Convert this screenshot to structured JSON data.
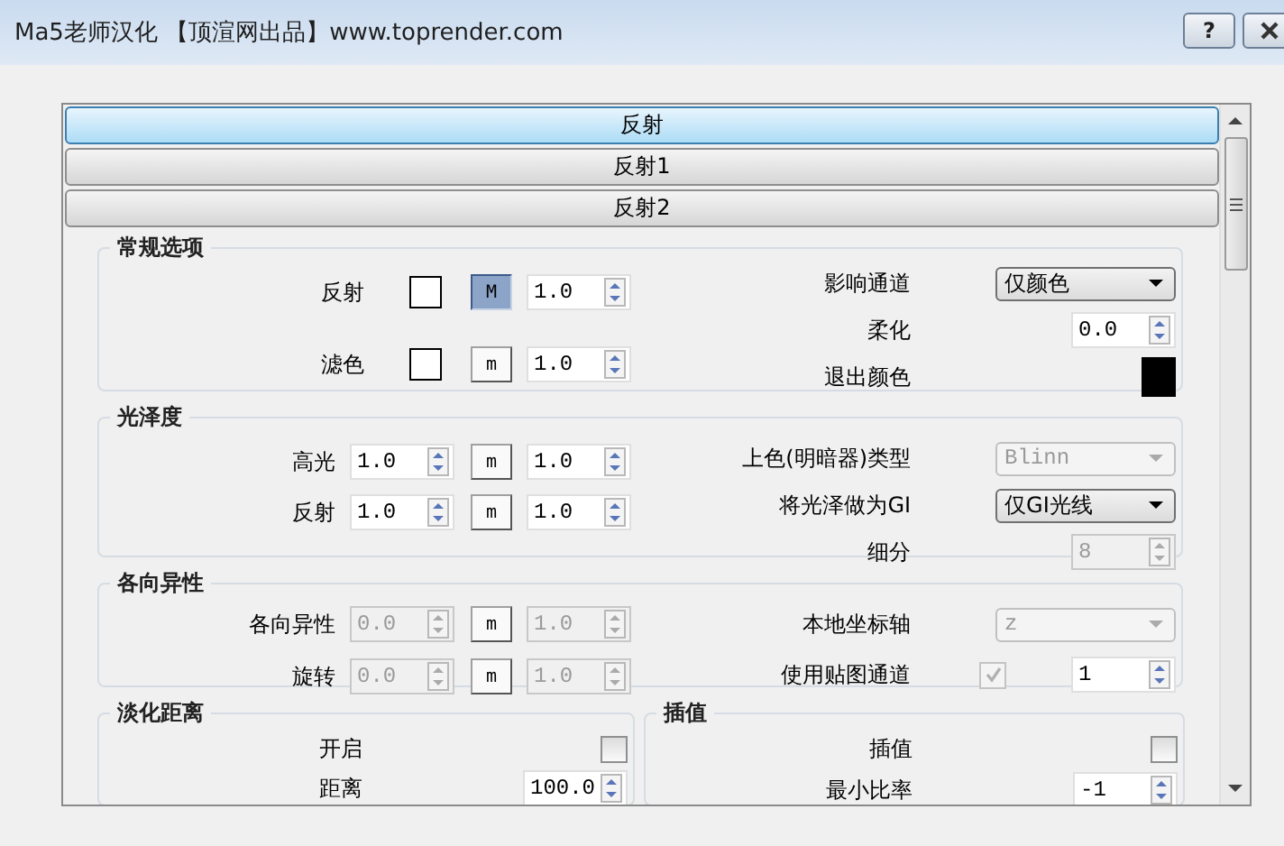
{
  "window": {
    "title": "Ma5老师汉化 【顶渲网出品】www.toprender.com",
    "help_button": "?"
  },
  "rollouts": [
    {
      "label": "反射",
      "selected": true
    },
    {
      "label": "反射1",
      "selected": false
    },
    {
      "label": "反射2",
      "selected": false
    }
  ],
  "sections": [
    {
      "kind": "split",
      "title": "常规选项",
      "left": [
        {
          "label": "反射",
          "controls": [
            {
              "kind": "swatch",
              "color": "#ffffff"
            },
            {
              "kind": "map_button",
              "label": "M",
              "pressed": true
            },
            {
              "kind": "spinner",
              "value": "1.0",
              "disabled": false
            }
          ]
        },
        {
          "label": "滤色",
          "controls": [
            {
              "kind": "swatch",
              "color": "#ffffff"
            },
            {
              "kind": "map_button",
              "label": "m",
              "pressed": false
            },
            {
              "kind": "spinner",
              "value": "1.0",
              "disabled": false
            }
          ]
        }
      ],
      "right": [
        {
          "label": "影响通道",
          "controls": [
            {
              "kind": "dropdown",
              "value": "仅颜色",
              "disabled": false
            }
          ]
        },
        {
          "label": "柔化",
          "controls": [
            {
              "kind": "spinner",
              "value": "0.0",
              "disabled": false
            }
          ]
        },
        {
          "label": "退出颜色",
          "controls": [
            {
              "kind": "swatch",
              "color": "#000000"
            }
          ]
        }
      ]
    },
    {
      "kind": "split",
      "title": "光泽度",
      "left": [
        {
          "label": "高光",
          "controls": [
            {
              "kind": "spinner",
              "value": "1.0",
              "disabled": false
            },
            {
              "kind": "map_button",
              "label": "m",
              "pressed": false
            },
            {
              "kind": "spinner",
              "value": "1.0",
              "disabled": false
            }
          ]
        },
        {
          "label": "反射",
          "controls": [
            {
              "kind": "spinner",
              "value": "1.0",
              "disabled": false
            },
            {
              "kind": "map_button",
              "label": "m",
              "pressed": false
            },
            {
              "kind": "spinner",
              "value": "1.0",
              "disabled": false
            }
          ]
        }
      ],
      "right": [
        {
          "label": "上色(明暗器)类型",
          "controls": [
            {
              "kind": "dropdown",
              "value": "Blinn",
              "disabled": true
            }
          ]
        },
        {
          "label": "将光泽做为GI",
          "controls": [
            {
              "kind": "dropdown",
              "value": "仅GI光线",
              "disabled": false
            }
          ]
        },
        {
          "label": "细分",
          "controls": [
            {
              "kind": "spinner",
              "value": "8",
              "disabled": true
            }
          ]
        }
      ]
    },
    {
      "kind": "split",
      "title": "各向异性",
      "left": [
        {
          "label": "各向异性",
          "controls": [
            {
              "kind": "spinner",
              "value": "0.0",
              "disabled": true
            },
            {
              "kind": "map_button",
              "label": "m",
              "pressed": false
            },
            {
              "kind": "spinner",
              "value": "1.0",
              "disabled": true
            }
          ]
        },
        {
          "label": "旋转",
          "controls": [
            {
              "kind": "spinner",
              "value": "0.0",
              "disabled": true
            },
            {
              "kind": "map_button",
              "label": "m",
              "pressed": false
            },
            {
              "kind": "spinner",
              "value": "1.0",
              "disabled": true
            }
          ]
        }
      ],
      "right": [
        {
          "label": "本地坐标轴",
          "controls": [
            {
              "kind": "dropdown",
              "value": "z",
              "disabled": true
            }
          ]
        },
        {
          "label": "使用贴图通道",
          "controls": [
            {
              "kind": "checkbox",
              "checked": true,
              "disabled": true
            },
            {
              "kind": "spinner",
              "value": "1",
              "disabled": false
            }
          ]
        }
      ]
    },
    {
      "kind": "half",
      "title": "淡化距离",
      "rows": [
        {
          "label": "开启",
          "controls": [
            {
              "kind": "checkbox",
              "checked": false,
              "disabled": false
            }
          ]
        },
        {
          "label": "距离",
          "controls": [
            {
              "kind": "spinner",
              "value": "100.0",
              "disabled": false
            }
          ]
        }
      ]
    },
    {
      "kind": "half",
      "title": "插值",
      "rows": [
        {
          "label": "插值",
          "controls": [
            {
              "kind": "checkbox",
              "checked": false,
              "disabled": false
            }
          ]
        },
        {
          "label": "最小比率",
          "controls": [
            {
              "kind": "spinner",
              "value": "-1",
              "disabled": false
            }
          ]
        }
      ]
    }
  ]
}
